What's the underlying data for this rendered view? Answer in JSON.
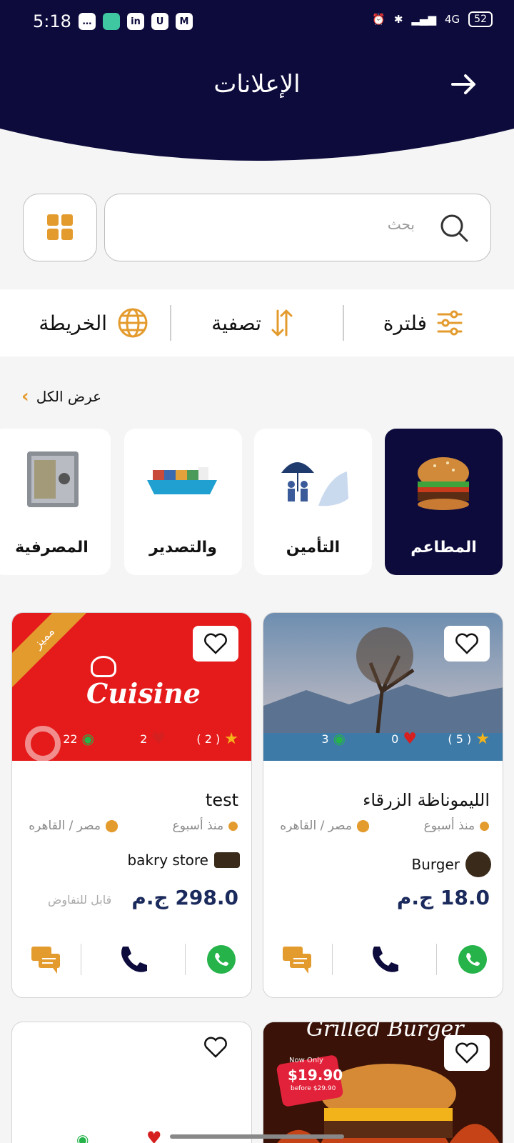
{
  "status_bar": {
    "time": "5:18",
    "network": "4G",
    "battery": "52"
  },
  "header": {
    "title": "الإعلانات"
  },
  "search": {
    "placeholder": "بحث"
  },
  "tools": {
    "filter": "فلترة",
    "sort": "تصفية",
    "map": "الخريطة"
  },
  "categories_header": {
    "show_all": "عرض الكل"
  },
  "categories": [
    {
      "label": "المطاعم",
      "icon": "burger"
    },
    {
      "label": "التأمين",
      "icon": "insurance-umbrella"
    },
    {
      "label": "والتصدير",
      "icon": "cargo-ship"
    },
    {
      "label": "المصرفية",
      "icon": "bank-safe"
    }
  ],
  "ads": [
    {
      "title": "الليموناظة الزرقاء",
      "time": "منذ أسبوع",
      "location": "مصر / القاهره",
      "store": "Burger",
      "price": "18.0 ج.م",
      "negotiable": "",
      "rating": "( 5 )",
      "likes": "0",
      "views": "3",
      "featured": ""
    },
    {
      "title": "test",
      "time": "منذ أسبوع",
      "location": "مصر / القاهره",
      "store": "bakry store",
      "price": "298.0 ج.م",
      "negotiable": "قابل للتفاوض",
      "rating": "( 2 )",
      "likes": "2",
      "views": "22",
      "featured": "مميز",
      "image_text": "Cuisine"
    }
  ],
  "promo": {
    "line1": "Now Only",
    "price": "$19.90",
    "was": "before $29.90",
    "banner": "Grilled Burger"
  },
  "colors": {
    "navy": "#0d0b3c",
    "accent": "#e49b2e",
    "price": "#1b2a5c",
    "whatsapp": "#25b34a",
    "red": "#d62020"
  }
}
